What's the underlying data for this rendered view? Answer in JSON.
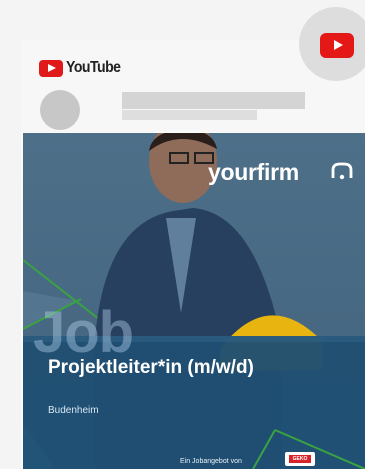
{
  "header": {
    "brand": "YouTube"
  },
  "video": {
    "brand": "yourfirm",
    "watermark": "Job",
    "title": "Projektleiter*in (m/w/d)",
    "location": "Budenheim",
    "offer_text": "Ein Jobangebot von",
    "company_logo": "GEKO"
  },
  "colors": {
    "youtube_red": "#e01a1a",
    "brand_blue": "#4d6f88",
    "accent_green": "#3aa341"
  },
  "icons": {
    "youtube": "youtube-play-icon",
    "share": "youtube-icon",
    "brand": "yourfirm-icon"
  }
}
